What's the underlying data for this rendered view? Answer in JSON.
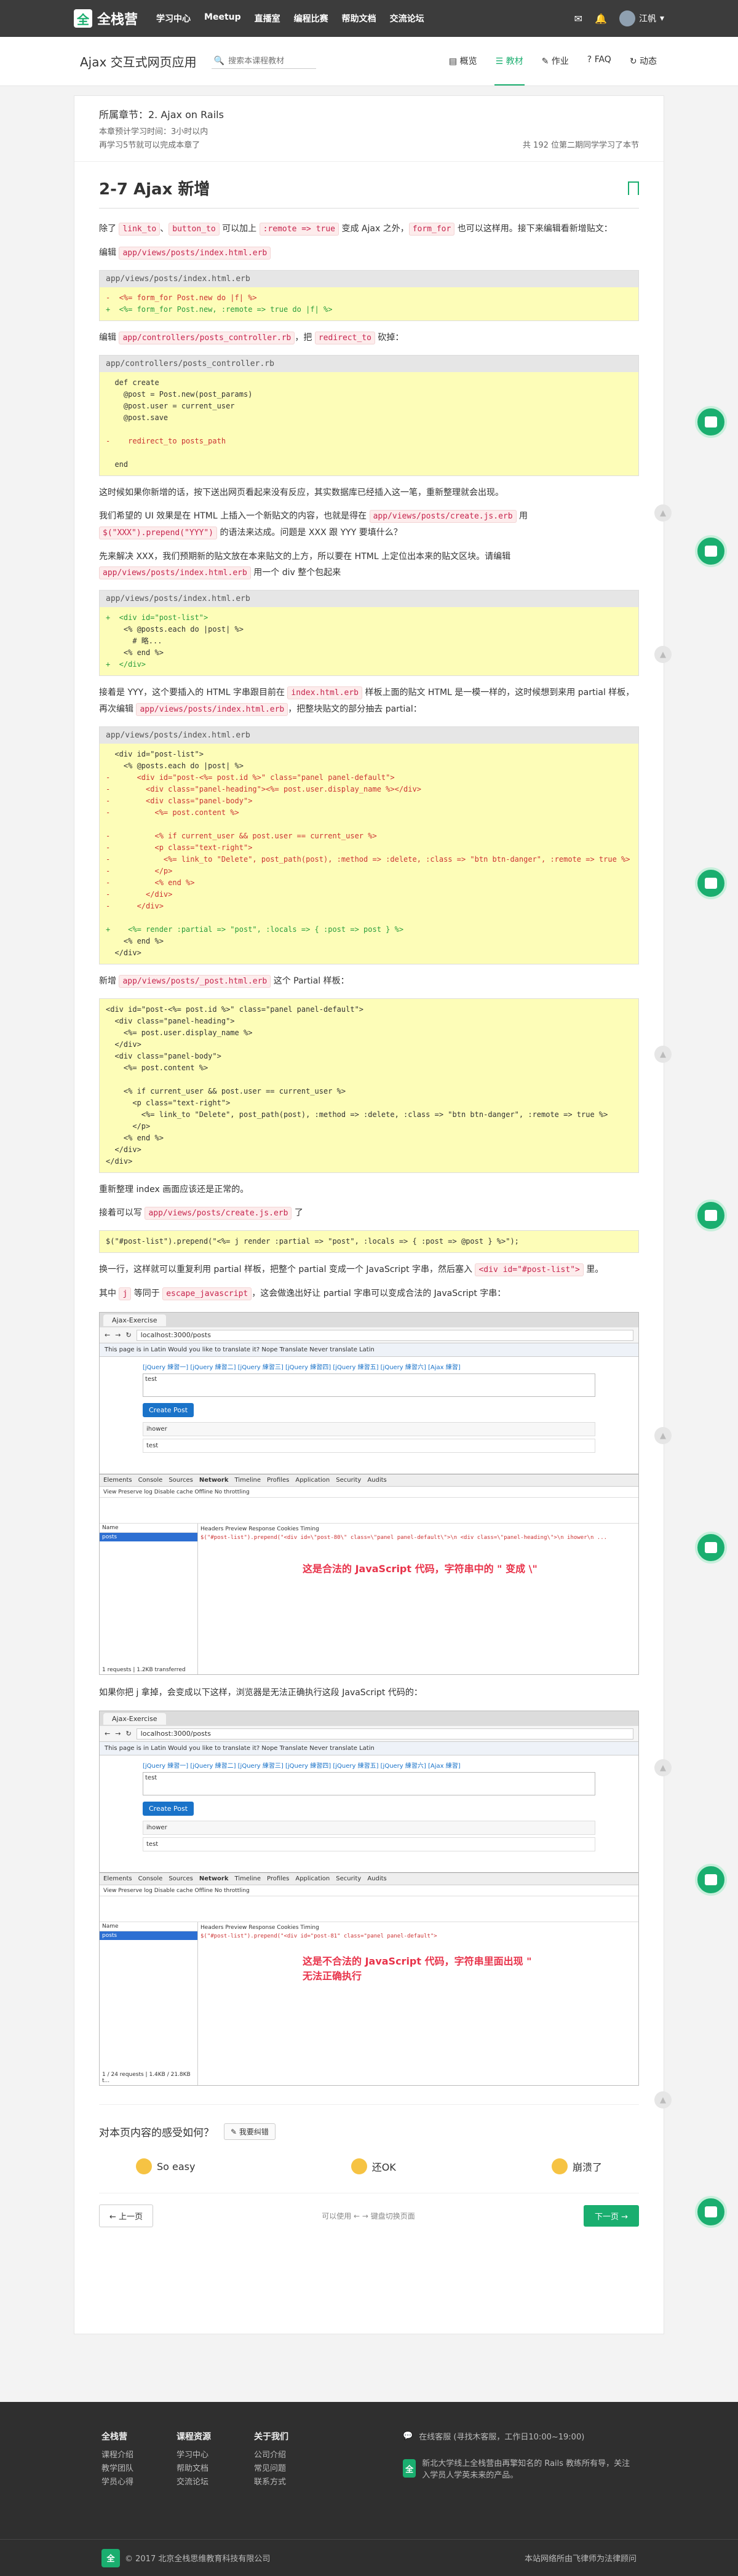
{
  "nav": {
    "logo": "全栈营",
    "links": [
      "学习中心",
      "Meetup",
      "直播室",
      "编程比赛",
      "帮助文档",
      "交流论坛"
    ],
    "user": "江帆"
  },
  "course": {
    "title": "Ajax 交互式网页应用",
    "search_placeholder": "搜索本课程教材",
    "tabs": [
      "概览",
      "教材",
      "作业",
      "FAQ",
      "动态"
    ],
    "active_tab": "教材"
  },
  "chapter": {
    "title": "所属章节：2. Ajax on Rails",
    "time": "本章预计学习时间：3小时以内",
    "finish": "再学习5节就可以完成本章了",
    "rank": "共 192 位第二期同学学习了本节"
  },
  "article": {
    "title": "2-7 Ajax 新增",
    "p1a": "除了",
    "p1b": "link_to",
    "p1c": "、",
    "p1d": "button_to",
    "p1e": "可以加上",
    "p1f": ":remote => true",
    "p1g": "变成 Ajax 之外，",
    "p1h": "form_for",
    "p1i": "也可以这样用。接下来编辑看新增贴文：",
    "p2a": "编辑",
    "p2b": "app/views/posts/index.html.erb",
    "code1_file": "app/views/posts/index.html.erb",
    "code1": [
      "-  <%= form_for Post.new do |f| %>",
      "+  <%= form_for Post.new, :remote => true do |f| %>"
    ],
    "p3a": "编辑",
    "p3b": "app/controllers/posts_controller.rb",
    "p3c": "，把",
    "p3d": "redirect_to",
    "p3e": "砍掉：",
    "code2_file": "app/controllers/posts_controller.rb",
    "code2": [
      "  def create",
      "    @post = Post.new(post_params)",
      "    @post.user = current_user",
      "    @post.save",
      "",
      "-    redirect_to posts_path",
      "",
      "  end"
    ],
    "p4": "这时候如果你新增的话，按下送出网页看起来没有反应，其实数据库已经插入这一笔，重新整理就会出现。",
    "p5a": "我们希望的 UI 效果是在 HTML 上插入一个新贴文的内容，也就是得在",
    "p5b": "app/views/posts/create.js.erb",
    "p5c": "用",
    "p5d": "$(\"XXX\").prepend(\"YYY\")",
    "p5e": "的语法来达成。问题是 XXX 跟 YYY 要填什么？",
    "p6a": "先来解决 XXX，我们预期新的贴文放在本来贴文的上方，所以要在 HTML 上定位出本来的贴文区块。请编辑",
    "p6b": "app/views/posts/index.html.erb",
    "p6c": "用一个 div 整个包起来",
    "code3_file": "app/views/posts/index.html.erb",
    "code3": [
      "+  <div id=\"post-list\">",
      "    <% @posts.each do |post| %>",
      "      # 略...",
      "    <% end %>",
      "+  </div>"
    ],
    "p7a": "接着是 YYY，这个要插入的 HTML 字串跟目前在",
    "p7b": "index.html.erb",
    "p7c": "样板上面的贴文 HTML 是一模一样的，这时候想到来用 partial 样板，再次编辑",
    "p7d": "app/views/posts/index.html.erb",
    "p7e": "，把整块贴文的部分抽去 partial：",
    "code4_file": "app/views/posts/index.html.erb",
    "code4": [
      "  <div id=\"post-list\">",
      "    <% @posts.each do |post| %>",
      "-      <div id=\"post-<%= post.id %>\" class=\"panel panel-default\">",
      "-        <div class=\"panel-heading\"><%= post.user.display_name %></div>",
      "-        <div class=\"panel-body\">",
      "-          <%= post.content %>",
      "",
      "-          <% if current_user && post.user == current_user %>",
      "-          <p class=\"text-right\">",
      "-            <%= link_to \"Delete\", post_path(post), :method => :delete, :class => \"btn btn-danger\", :remote => true %>",
      "-          </p>",
      "-          <% end %>",
      "-        </div>",
      "-      </div>",
      "",
      "+    <%= render :partial => \"post\", :locals => { :post => post } %>",
      "    <% end %>",
      "  </div>"
    ],
    "p8a": "新增",
    "p8b": "app/views/posts/_post.html.erb",
    "p8c": "这个 Partial 样板：",
    "code5": [
      "<div id=\"post-<%= post.id %>\" class=\"panel panel-default\">",
      "  <div class=\"panel-heading\">",
      "    <%= post.user.display_name %>",
      "  </div>",
      "  <div class=\"panel-body\">",
      "    <%= post.content %>",
      "",
      "    <% if current_user && post.user == current_user %>",
      "      <p class=\"text-right\">",
      "        <%= link_to \"Delete\", post_path(post), :method => :delete, :class => \"btn btn-danger\", :remote => true %>",
      "      </p>",
      "    <% end %>",
      "  </div>",
      "</div>"
    ],
    "p9": "重新整理 index 画面应该还是正常的。",
    "p10a": "接着可以写",
    "p10b": "app/views/posts/create.js.erb",
    "p10c": "了",
    "code6": [
      "$(\"#post-list\").prepend(\"<%= j render :partial => \"post\", :locals => { :post => @post } %>\");"
    ],
    "p11a": "换一行，这样就可以重复利用 partial 样板，把整个 partial 变成一个 JavaScript 字串，然后塞入",
    "p11b": "<div id=\"#post-list\">",
    "p11c": "里。",
    "p12a": "其中",
    "p12b": "j",
    "p12c": "等同于",
    "p12d": "escape_javascript",
    "p12e": "，这会做逸出好让 partial 字串可以变成合法的 JavaScript 字串：",
    "p13": "如果你把 j 拿掉，会变成以下这样，浏览器是无法正确执行这段 JavaScript 代码的：",
    "annot1": "这是合法的 JavaScript 代码，字符串中的 \" 变成 \\\"",
    "annot2": "这是不合法的 JavaScript 代码，字符串里面出现 \" 无法正确执行"
  },
  "shot": {
    "tab": "Ajax-Exercise",
    "url": "localhost:3000/posts",
    "translate": "This page is in Latin  Would you like to translate it?  Nope  Translate  Never translate Latin",
    "links": "[jQuery 練習一] [jQuery 練習二] [jQuery 練習三] [jQuery 練習四] [jQuery 練習五] [jQuery 練習六] [Ajax 練習]",
    "text": "test",
    "button": "Create Post",
    "user": "ihower",
    "post": "test",
    "devtabs": [
      "Elements",
      "Console",
      "Sources",
      "Network",
      "Timeline",
      "Profiles",
      "Application",
      "Security",
      "Audits"
    ],
    "devtools": "View  Preserve log  Disable cache  Offline  No throttling",
    "req": "posts",
    "name_col": "Name",
    "detail_tabs": "Headers  Preview  Response  Cookies  Timing",
    "resp1": "$(\"#post-list\").prepend(\"<div id=\\\"post-80\\\" class=\\\"panel panel-default\\\">\\n  <div class=\\\"panel-heading\\\">\\n    ihower\\n ...",
    "resp2": "$(\"#post-list\").prepend(\"<div id=\"post-81\" class=\"panel panel-default\">",
    "footer1": "1 requests | 1.2KB transferred",
    "footer2": "1 / 24 requests | 1.4KB / 21.8KB t..."
  },
  "feedback": {
    "question": "对本页内容的感受如何？",
    "report": "我要纠错",
    "opt1": "So easy",
    "opt2": "还OK",
    "opt3": "崩溃了"
  },
  "pager": {
    "prev": "上一页",
    "mid": "可以使用  ←  →  键盘切换页面",
    "next": "下一页"
  },
  "footer": {
    "col1_title": "全栈营",
    "col1": [
      "课程介绍",
      "教学团队",
      "学员心得"
    ],
    "col2_title": "课程资源",
    "col2": [
      "学习中心",
      "帮助文档",
      "交流论坛"
    ],
    "col3_title": "关于我们",
    "col3": [
      "公司介绍",
      "常见问题",
      "联系方式"
    ],
    "service": "在线客服 (寻找木客服，工作日10:00~19:00)",
    "slogan": "新北大学线上全栈营由再擎知名的 Rails 教练所有导，关注入学员人学英未来的产品。",
    "copyright": "© 2017 北京全栈思维教育科技有限公司",
    "icp": "本站网络所由飞律师为法律顾问"
  }
}
